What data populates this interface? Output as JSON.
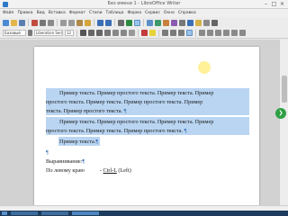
{
  "window": {
    "title": "Без имени 1 - LibreOffice Writer"
  },
  "menubar": {
    "items": [
      "Файл",
      "Правка",
      "Вид",
      "Вставка",
      "Формат",
      "Стили",
      "Таблица",
      "Форма",
      "Сервис",
      "Окно",
      "Справка"
    ]
  },
  "toolbar": {
    "style_value": "Базовый",
    "font_value": "Liberation Serif",
    "size_value": "12"
  },
  "document": {
    "para1": [
      "Пример текста. Пример простого текста. Пример текста. Пример",
      "простого текста. Пример текста. Пример простого текста. Пример",
      "текста. Пример простого текста."
    ],
    "para2": [
      "Пример текста. Пример простого текста. Пример текста. Пример",
      "простого текста. Пример текста. Пример простого текста."
    ],
    "para3": "Пример текста.",
    "pilcrow": "¶",
    "heading": "Выравнивание:",
    "rule_left": "По левому краю",
    "rule_dash": "-",
    "shortcut": "Ctrl-L",
    "shortcut_suffix": "(Left)"
  },
  "colors": {
    "selection": "#b9d5f2",
    "accent": "#2e79c8",
    "fab": "#2ea043"
  }
}
